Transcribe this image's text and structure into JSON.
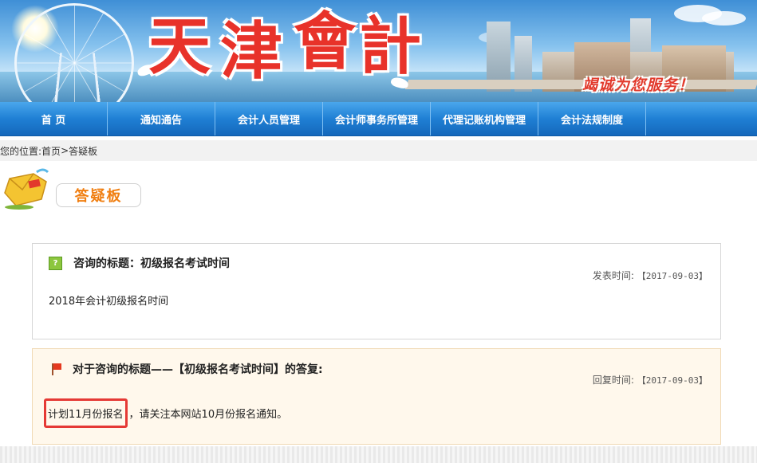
{
  "banner": {
    "title_chars": [
      "天",
      "津",
      "會",
      "計"
    ],
    "slogan": "竭诚为您服务！"
  },
  "nav": {
    "items": [
      {
        "label": "首  页"
      },
      {
        "label": "通知通告"
      },
      {
        "label": "会计人员管理"
      },
      {
        "label": "会计师事务所管理"
      },
      {
        "label": "代理记账机构管理"
      },
      {
        "label": "会计法规制度"
      }
    ]
  },
  "breadcrumb": {
    "prefix": "您的位置:",
    "home": "首页",
    "separator": ">",
    "current": "答疑板"
  },
  "board": {
    "title": "答疑板"
  },
  "question": {
    "icon": "question-icon",
    "title": "咨询的标题：初级报名考试时间",
    "date_label": "发表时间:",
    "date_value": "【2017-09-03】",
    "body": "2018年会计初级报名时间"
  },
  "answer": {
    "icon": "flag-icon",
    "title": "对于咨询的标题——【初级报名考试时间】的答复:",
    "date_label": "回复时间:",
    "date_value": "【2017-09-03】",
    "body_highlight": "计划11月份报名",
    "body_rest": "，请关注本网站10月份报名通知。"
  },
  "colors": {
    "nav_blue": "#1f7fd4",
    "title_red": "#e8322a",
    "board_orange": "#f07f12",
    "highlight_red": "#e53935",
    "answer_bg": "#fff8ec"
  }
}
